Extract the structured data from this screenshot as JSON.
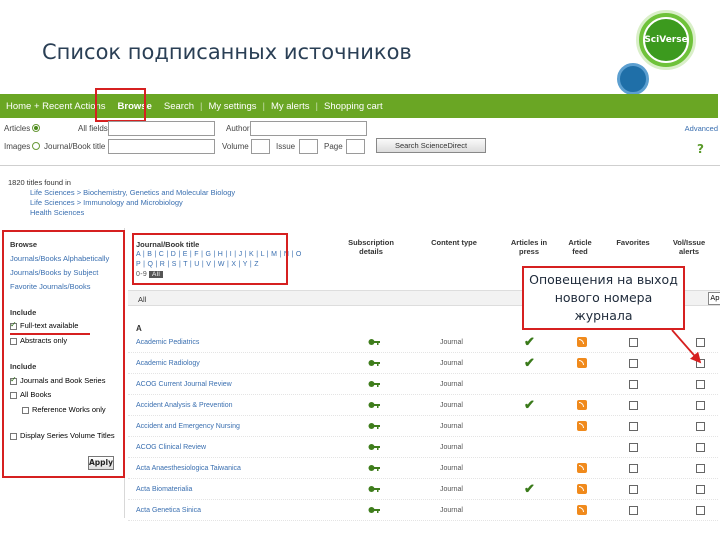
{
  "slide_title": "Список подписанных источников",
  "logo": {
    "text": "SciVerse"
  },
  "topnav": {
    "items": [
      "Home + Recent Actions",
      "Browse",
      "Search",
      "My settings",
      "My alerts",
      "Shopping cart"
    ]
  },
  "search": {
    "row1": {
      "radio_label": "Articles",
      "field1_label": "All fields",
      "field2_label": "Author"
    },
    "row2": {
      "radio_label": "Images",
      "field1_label": "Journal/Book title",
      "volume_label": "Volume",
      "issue_label": "Issue",
      "page_label": "Page"
    },
    "button_label": "Search ScienceDirect",
    "advanced_link": "Advanced",
    "help_link": "?"
  },
  "found": {
    "summary": "1820 titles found in",
    "paths": [
      "Life Sciences > Biochemistry, Genetics and Molecular Biology",
      "Life Sciences > Immunology and Microbiology",
      "Health Sciences"
    ]
  },
  "left": {
    "browse_heading": "Browse",
    "browse_links": [
      "Journals/Books Alphabetically",
      "Journals/Books by Subject",
      "Favorite Journals/Books"
    ],
    "include_heading": "Include",
    "include1": [
      "Full-text available",
      "Abstracts only"
    ],
    "include2_heading": "Include",
    "include2": [
      "Journals and Book Series",
      "All Books",
      "Reference Works only"
    ],
    "display_series": "Display Series Volume Titles",
    "apply_label": "Apply"
  },
  "table": {
    "col_title": "Journal/Book title",
    "col_subscription": "Subscription details",
    "col_content": "Content type",
    "col_articles": "Articles in press",
    "col_feed": "Article feed",
    "col_favorites": "Favorites",
    "col_alerts": "Vol/Issue alerts",
    "az_line1": "A | B | C | D | E | F | G | H | I | J | K | L | M | N | O",
    "az_line2": "P | Q | R | S | T | U | V | W | X | Y | Z",
    "az_09": "0-9",
    "az_all": "All",
    "filter_all": "All",
    "apply_short": "Ap",
    "letter": "A",
    "rows": [
      {
        "title": "Academic Pediatrics",
        "type": "Journal",
        "in_press": true,
        "feed": true
      },
      {
        "title": "Academic Radiology",
        "type": "Journal",
        "in_press": true,
        "feed": true
      },
      {
        "title": "ACOG Current Journal Review",
        "type": "Journal",
        "in_press": false,
        "feed": false
      },
      {
        "title": "Accident Analysis & Prevention",
        "type": "Journal",
        "in_press": true,
        "feed": true
      },
      {
        "title": "Accident and Emergency Nursing",
        "type": "Journal",
        "in_press": false,
        "feed": true
      },
      {
        "title": "ACOG Clinical Review",
        "type": "Journal",
        "in_press": false,
        "feed": false
      },
      {
        "title": "Acta Anaesthesiologica Taiwanica",
        "type": "Journal",
        "in_press": false,
        "feed": true
      },
      {
        "title": "Acta Biomaterialia",
        "type": "Journal",
        "in_press": true,
        "feed": true
      },
      {
        "title": "Acta Genetica Sinica",
        "type": "Journal",
        "in_press": false,
        "feed": true
      }
    ]
  },
  "callout": {
    "text": "Оповещения на выход нового номера журнала"
  },
  "colors": {
    "nav_green": "#6aa624",
    "highlight_red": "#d62020",
    "link_blue": "#3a6fb0"
  }
}
